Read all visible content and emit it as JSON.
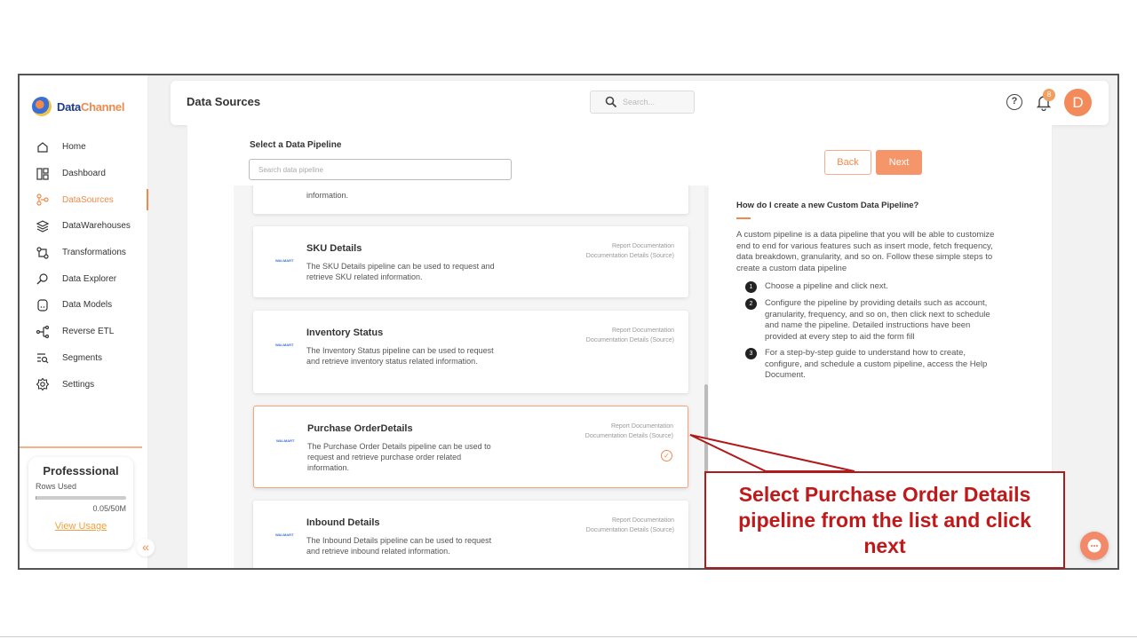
{
  "app": {
    "logo_text_a": "Data",
    "logo_text_b": "Channel"
  },
  "sidebar": {
    "items": [
      {
        "label": "Home",
        "icon": "home-icon",
        "active": false
      },
      {
        "label": "Dashboard",
        "icon": "dashboard-icon",
        "active": false
      },
      {
        "label": "DataSources",
        "icon": "datasources-icon",
        "active": true
      },
      {
        "label": "DataWarehouses",
        "icon": "datawarehouses-icon",
        "active": false
      },
      {
        "label": "Transformations",
        "icon": "transformations-icon",
        "active": false
      },
      {
        "label": "Data Explorer",
        "icon": "data-explorer-icon",
        "active": false
      },
      {
        "label": "Data Models",
        "icon": "data-models-icon",
        "active": false
      },
      {
        "label": "Reverse ETL",
        "icon": "reverse-etl-icon",
        "active": false
      },
      {
        "label": "Segments",
        "icon": "segments-icon",
        "active": false
      },
      {
        "label": "Settings",
        "icon": "settings-icon",
        "active": false
      }
    ],
    "plan": {
      "title": "Professsional",
      "rows_label": "Rows Used",
      "usage": "0.05/50M",
      "usage_fraction": 0.001,
      "link": "View Usage"
    },
    "collapse_glyph": "«"
  },
  "header": {
    "title": "Data Sources",
    "search_placeholder": "Search...",
    "help_glyph": "?",
    "notification_count": "8",
    "avatar_initial": "D"
  },
  "pipeline": {
    "select_label": "Select a Data Pipeline",
    "search_placeholder": "Search data pipeline",
    "back_label": "Back",
    "next_label": "Next",
    "partial_card_text": "information.",
    "link_report": "Report Documentation",
    "link_details": "Documentation Details (Source)",
    "thumb_text": "WALMART",
    "cards": [
      {
        "name": "SKU Details",
        "desc": "The SKU Details pipeline can be used to request and retrieve SKU related information.",
        "selected": false
      },
      {
        "name": "Inventory Status",
        "desc": "The Inventory Status pipeline can be used to request and retrieve inventory status related information.",
        "selected": false
      },
      {
        "name": "Purchase OrderDetails",
        "desc": "The Purchase Order Details pipeline can be used to request and retrieve purchase order related information.",
        "selected": true
      },
      {
        "name": "Inbound Details",
        "desc": "The Inbound Details pipeline can be used to request and retrieve inbound related information.",
        "selected": false
      }
    ]
  },
  "help": {
    "title": "How do I create a new Custom Data Pipeline?",
    "body": "A custom pipeline is a data pipeline that you will be able to customize end to end for various features such as insert mode, fetch frequency, data breakdown, granularity, and so on. Follow these simple steps to create a custom data pipeline",
    "steps": [
      {
        "num": "1",
        "text": "Choose a pipeline and click next."
      },
      {
        "num": "2",
        "text": "Configure the pipeline by providing details such as account, granularity, frequency, and so on, then click next to schedule and name the pipeline. Detailed instructions have been provided at every step to aid the form fill"
      },
      {
        "num": "3",
        "text": "For a step-by-step guide to understand how to create, configure, and schedule a custom pipeline, access the Help Document."
      }
    ]
  },
  "annotation": {
    "text": "Select Purchase Order  Details pipeline from the list and click next",
    "color": "#c0191a"
  }
}
